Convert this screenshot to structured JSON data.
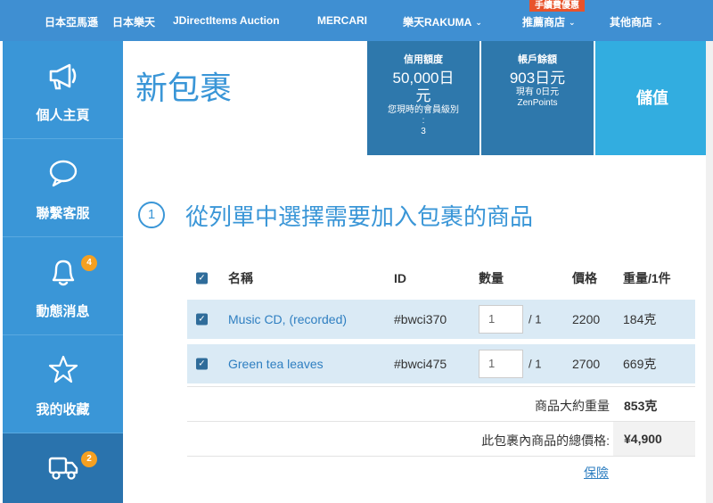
{
  "topnav": {
    "items": [
      {
        "label": "日本亞馬遜"
      },
      {
        "label": "日本樂天"
      },
      {
        "label": "JDirectItems Auction"
      },
      {
        "label": "MERCARI"
      },
      {
        "label": "樂天RAKUMA"
      },
      {
        "label": "推薦商店"
      },
      {
        "label": "其他商店"
      }
    ],
    "promo_badge": "手續費優惠"
  },
  "sidebar": {
    "items": [
      {
        "label": "個人主頁",
        "icon": "megaphone-icon"
      },
      {
        "label": "聯繫客服",
        "icon": "chat-bubble-icon"
      },
      {
        "label": "動態消息",
        "icon": "bell-icon",
        "badge": "4"
      },
      {
        "label": "我的收藏",
        "icon": "star-icon"
      },
      {
        "label": "",
        "icon": "truck-icon",
        "badge": "2"
      }
    ]
  },
  "page": {
    "title": "新包裹"
  },
  "account": {
    "credit_heading": "信用額度",
    "credit_value_line1": "50,000日",
    "credit_value_line2": "元",
    "member_level_label_line1": "您現時的會員級別",
    "member_level_label_line2": ":",
    "member_level_value": "3",
    "balance_heading": "帳戶餘額",
    "balance_value": "903日元",
    "zen_points_line1": "現有 0日元",
    "zen_points_line2": "ZenPoints",
    "topup_label": "儲值"
  },
  "step": {
    "number": "1",
    "title": "從列單中選擇需要加入包裹的商品"
  },
  "table": {
    "headers": {
      "name": "名稱",
      "id": "ID",
      "qty": "數量",
      "price": "價格",
      "weight": "重量/1件"
    },
    "rows": [
      {
        "name": "Music CD, (recorded)",
        "id": "#bwci370",
        "qty": "1",
        "qty_max": "/ 1",
        "price": "2200",
        "weight": "184克"
      },
      {
        "name": "Green tea leaves",
        "id": "#bwci475",
        "qty": "1",
        "qty_max": "/ 1",
        "price": "2700",
        "weight": "669克"
      }
    ],
    "summary": {
      "weight_label": "商品大約重量",
      "weight_value": "853克",
      "total_label": "此包裹內商品的總價格:",
      "total_value": "¥4,900",
      "insurance_link": "保險"
    }
  },
  "colors": {
    "nav_bg": "#3f8fd2",
    "sidebar_bg": "#3a96d7",
    "account_bg": "#2e78ac",
    "topup_bg": "#32ade0",
    "accent": "#3a96d7",
    "badge": "#f5a021"
  }
}
